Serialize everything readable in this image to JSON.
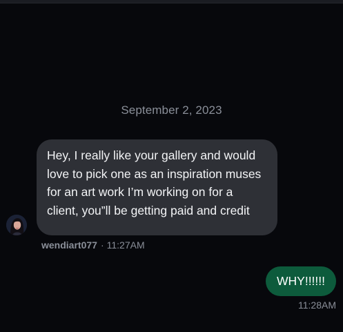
{
  "conversation": {
    "date_separator": "September 2, 2023",
    "messages": [
      {
        "direction": "incoming",
        "text": "Hey, I really like your gallery and would love to pick one as an inspiration muses for an art work I’m working on for a client, you”ll be getting paid and credit",
        "sender": "wendiart077",
        "separator": "·",
        "time": "11:27AM",
        "avatar": "profile-photo-woman-dark-hair"
      },
      {
        "direction": "outgoing",
        "text": "WHY!!!!!!",
        "time": "11:28AM"
      }
    ]
  },
  "colors": {
    "background": "#07080c",
    "incoming_bubble": "#2e3036",
    "outgoing_bubble": "#0d5b3c",
    "meta_text": "#8a8f99"
  }
}
